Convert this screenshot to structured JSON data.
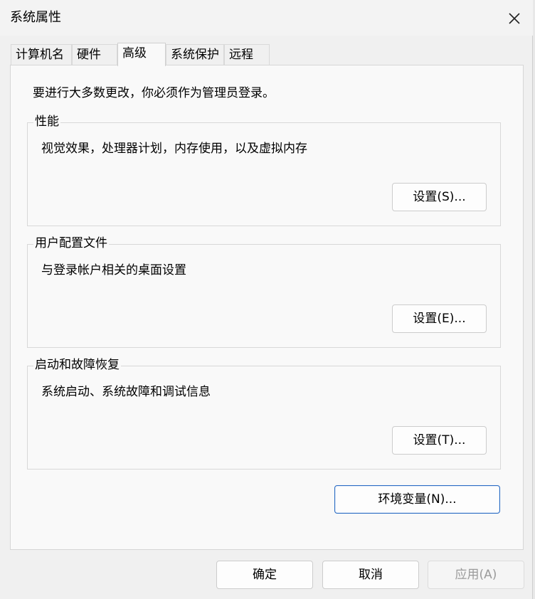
{
  "window": {
    "title": "系统属性"
  },
  "tabs": [
    {
      "label": "计算机名"
    },
    {
      "label": "硬件"
    },
    {
      "label": "高级",
      "active": true
    },
    {
      "label": "系统保护"
    },
    {
      "label": "远程"
    }
  ],
  "page": {
    "admin_note": "要进行大多数更改，你必须作为管理员登录。",
    "performance": {
      "label": "性能",
      "description": "视觉效果，处理器计划，内存使用，以及虚拟内存",
      "button": "设置(S)..."
    },
    "user_profiles": {
      "label": "用户配置文件",
      "description": "与登录帐户相关的桌面设置",
      "button": "设置(E)..."
    },
    "startup_recovery": {
      "label": "启动和故障恢复",
      "description": "系统启动、系统故障和调试信息",
      "button": "设置(T)..."
    },
    "env_button": "环境变量(N)..."
  },
  "footer": {
    "ok": "确定",
    "cancel": "取消",
    "apply": "应用(A)"
  },
  "icons": {
    "close": "close-icon"
  },
  "colors": {
    "focus_border": "#2b6cc4",
    "disabled_text": "#9a9a9a"
  }
}
